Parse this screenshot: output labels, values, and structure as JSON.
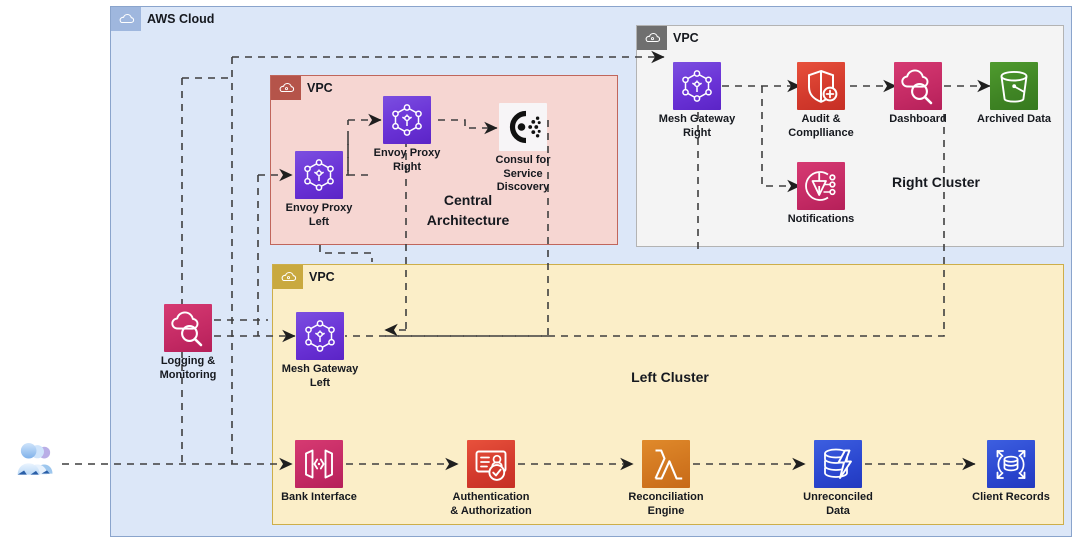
{
  "diagram": {
    "title": "AWS Cloud",
    "type": "aws-architecture-diagram"
  },
  "groups": {
    "aws_cloud": {
      "label": "AWS Cloud",
      "icon": "aws-cloud-icon",
      "color": "#dce7f8",
      "border": "#8aa4cc"
    },
    "central_vpc": {
      "label": "VPC",
      "icon": "vpc-cloud-icon",
      "title": "Central\nArchitecture",
      "title_line1": "Central",
      "title_line2": "Architecture",
      "color": "#f6d6d2",
      "border": "#c0665c"
    },
    "right_vpc": {
      "label": "VPC",
      "icon": "vpc-cloud-icon",
      "title": "Right Cluster",
      "color": "#f4f4f4",
      "border": "#b3b3b3"
    },
    "left_vpc": {
      "label": "VPC",
      "icon": "vpc-cloud-icon",
      "title": "Left Cluster",
      "color": "#fbeec8",
      "border": "#cdae4a"
    }
  },
  "actor": {
    "name": "users-actor",
    "icon": "users-icon"
  },
  "nodes": {
    "logging_monitoring": {
      "label_line1": "Logging &",
      "label_line2": "Monitoring",
      "icon": "cloudwatch-icon",
      "color": "#c42a64"
    },
    "envoy_proxy_left": {
      "label_line1": "Envoy Proxy",
      "label_line2": "Left",
      "icon": "service-mesh-icon",
      "color": "#6a32d6"
    },
    "envoy_proxy_right": {
      "label_line1": "Envoy Proxy",
      "label_line2": "Right",
      "icon": "service-mesh-icon",
      "color": "#6a32d6"
    },
    "consul": {
      "label_line1": "Consul for",
      "label_line2": "Service",
      "label_line3": "Discovery",
      "icon": "consul-icon",
      "color": "#f7f5f7"
    },
    "mesh_gateway_right": {
      "label_line1": "Mesh Gateway",
      "label_line2": "Right",
      "icon": "service-mesh-icon",
      "color": "#6a32d6"
    },
    "audit_compliance": {
      "label_line1": "Audit &",
      "label_line2": "Complliance",
      "icon": "shield-plus-icon",
      "color": "#d2392c"
    },
    "dashboard": {
      "label": "Dashboard",
      "icon": "cloudwatch-icon",
      "color": "#c42a64"
    },
    "archived_data": {
      "label": "Archived Data",
      "icon": "s3-bucket-icon",
      "color": "#3f8424"
    },
    "notifications": {
      "label": "Notifications",
      "icon": "sns-notification-icon",
      "color": "#c42a64"
    },
    "mesh_gateway_left": {
      "label_line1": "Mesh Gateway",
      "label_line2": "Left",
      "icon": "service-mesh-icon",
      "color": "#6a32d6"
    },
    "bank_interface": {
      "label": "Bank Interface",
      "icon": "api-gateway-icon",
      "color": "#c42a64"
    },
    "auth": {
      "label_line1": "Authentication",
      "label_line2": "& Authorization",
      "icon": "identity-verification-icon",
      "color": "#d2392c"
    },
    "reconciliation_engine": {
      "label_line1": "Reconciliation",
      "label_line2": "Engine",
      "icon": "lambda-icon",
      "color": "#d1761f"
    },
    "unreconciled_data": {
      "label_line1": "Unreconciled",
      "label_line2": "Data",
      "icon": "database-lightning-icon",
      "color": "#2a46cf"
    },
    "client_records": {
      "label": "Client Records",
      "icon": "dynamodb-icon",
      "color": "#2a46cf"
    }
  },
  "connector_style": {
    "stroke": "#3f3f3f",
    "dash": "7 6",
    "width": 1.6
  }
}
